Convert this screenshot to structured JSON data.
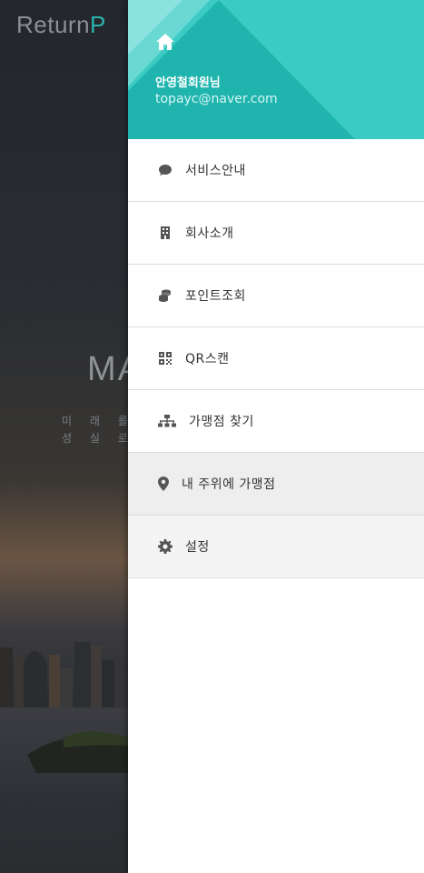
{
  "background": {
    "logo_text": "Return",
    "logo_accent": "P",
    "hero_title": "MA",
    "hero_sub_line1": "미 래 를  저",
    "hero_sub_line2": "성 실 로  최"
  },
  "drawer": {
    "header": {
      "home_icon": "home-icon",
      "user_name": "안영철회원님",
      "user_email": "topayc@naver.com",
      "color": "#3ccbc4"
    },
    "items": [
      {
        "label": "서비스안내",
        "icon": "chat-bubble-icon"
      },
      {
        "label": "회사소개",
        "icon": "building-icon"
      },
      {
        "label": "포인트조회",
        "icon": "coins-icon"
      },
      {
        "label": "QR스캔",
        "icon": "qrcode-icon"
      },
      {
        "label": "가맹점 찾기",
        "icon": "sitemap-icon"
      },
      {
        "label": "내 주위에 가맹점",
        "icon": "map-marker-icon"
      },
      {
        "label": "설정",
        "icon": "gear-icon"
      }
    ]
  }
}
